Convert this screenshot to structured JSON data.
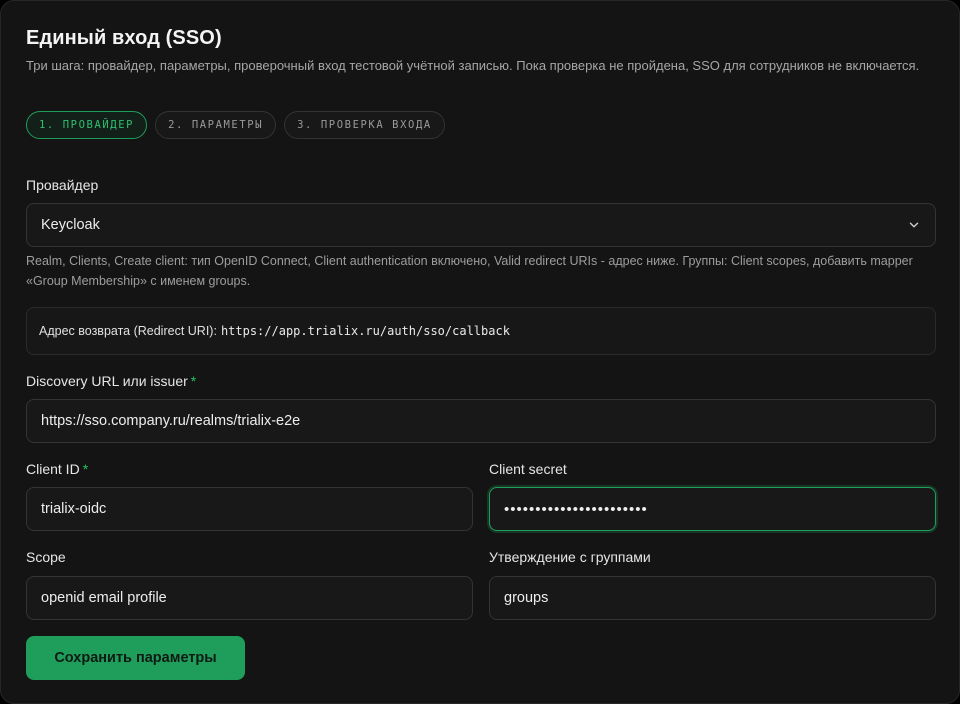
{
  "header": {
    "title": "Единый вход (SSO)",
    "subtitle": "Три шага: провайдер, параметры, проверочный вход тестовой учётной записью. Пока проверка не пройдена, SSO для сотрудников не включается."
  },
  "steps": [
    {
      "label": "1. ПРОВАЙДЕР",
      "active": true
    },
    {
      "label": "2. ПАРАМЕТРЫ",
      "active": false
    },
    {
      "label": "3. ПРОВЕРКА ВХОДА",
      "active": false
    }
  ],
  "provider": {
    "label": "Провайдер",
    "value": "Keycloak",
    "hint": "Realm, Clients, Create client: тип OpenID Connect, Client authentication включено, Valid redirect URIs - адрес ниже. Группы: Client scopes, добавить mapper «Group Membership» с именем groups."
  },
  "redirect": {
    "label": "Адрес возврата (Redirect URI):",
    "url": "https://app.trialix.ru/auth/sso/callback"
  },
  "discovery": {
    "label": "Discovery URL или issuer",
    "required_mark": "*",
    "value": "https://sso.company.ru/realms/trialix-e2e"
  },
  "client_id": {
    "label": "Client ID",
    "required_mark": "*",
    "value": "trialix-oidc"
  },
  "client_secret": {
    "label": "Client secret",
    "value": "•••••••••••••••••••••••"
  },
  "scope": {
    "label": "Scope",
    "value": "openid email profile"
  },
  "groups_claim": {
    "label": "Утверждение с группами",
    "value": "groups"
  },
  "actions": {
    "save_label": "Сохранить параметры"
  },
  "colors": {
    "accent": "#1f9d5b",
    "background": "#141414",
    "field_border": "#343434"
  }
}
